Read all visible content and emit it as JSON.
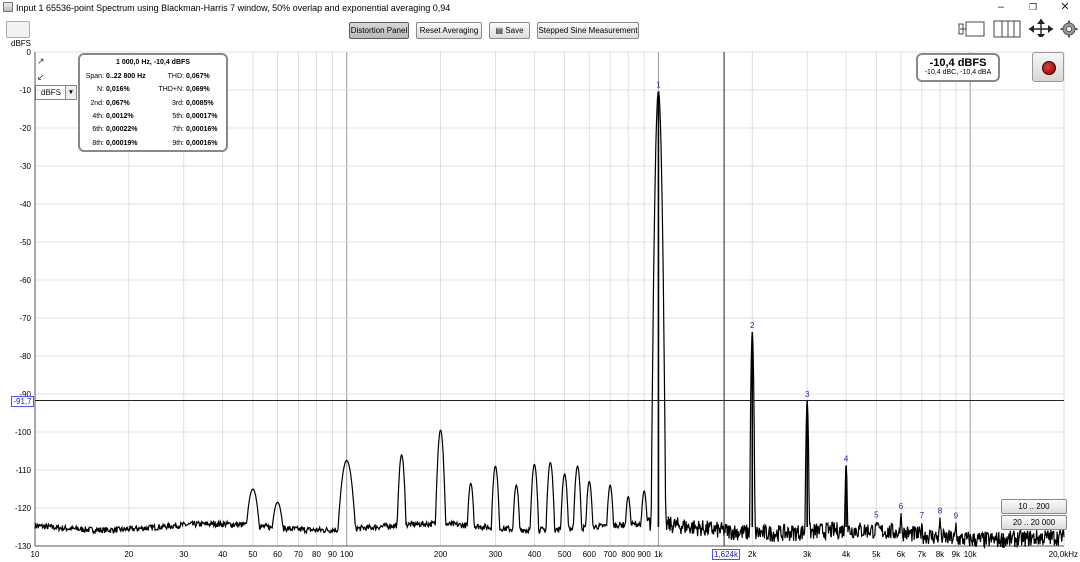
{
  "window": {
    "title": "Input 1 65536-point Spectrum using Blackman-Harris 7 window, 50% overlap and exponential averaging 0,94"
  },
  "toolbar": {
    "distortion": "Distortion Panel",
    "reset": "Reset Averaging",
    "save": "Save",
    "stepped": "Stepped Sine Measurement"
  },
  "unit_label": "dBFS",
  "unit_select": "dBFS",
  "info": {
    "header": "1 000,0 Hz, -10,4 dBFS",
    "rows": [
      [
        {
          "k": "Span:",
          "v": "0..22 800 Hz"
        },
        {
          "k": "THD:",
          "v": "0,067%"
        }
      ],
      [
        {
          "k": "N:",
          "v": "0,016%"
        },
        {
          "k": "THD+N:",
          "v": "0,069%"
        }
      ],
      [
        {
          "k": "2nd:",
          "v": "0,067%"
        },
        {
          "k": "3rd:",
          "v": "0,0085%"
        }
      ],
      [
        {
          "k": "4th:",
          "v": "0,0012%"
        },
        {
          "k": "5th:",
          "v": "0,00017%"
        }
      ],
      [
        {
          "k": "6th:",
          "v": "0,00022%"
        },
        {
          "k": "7th:",
          "v": "0,00016%"
        }
      ],
      [
        {
          "k": "8th:",
          "v": "0,00019%"
        },
        {
          "k": "9th:",
          "v": "0,00016%"
        }
      ]
    ]
  },
  "peak": {
    "level": "-10,4 dBFS",
    "weighted": "-10,4 dBC, -10,4 dBA"
  },
  "range": {
    "narrow": "10 .. 200",
    "wide": "20 .. 20 000"
  },
  "cursor": {
    "x_label": "1,624k",
    "y_label": "-91,7",
    "x": 1624,
    "y": -91.7
  },
  "colors": {
    "trace": "#000000",
    "grid_major": "#9a9a9a",
    "grid_minor": "#d8d8d8",
    "harmonic_label": "#1a1ac8"
  },
  "chart_data": {
    "type": "line",
    "x_scale": "log",
    "xlim": [
      10,
      20000
    ],
    "ylim": [
      -130,
      0
    ],
    "ylabel": "dBFS",
    "xlabel": "",
    "x_ticks": [
      {
        "v": 10,
        "l": "10"
      },
      {
        "v": 20,
        "l": "20"
      },
      {
        "v": 30,
        "l": "30"
      },
      {
        "v": 40,
        "l": "40"
      },
      {
        "v": 50,
        "l": "50"
      },
      {
        "v": 60,
        "l": "60"
      },
      {
        "v": 70,
        "l": "70"
      },
      {
        "v": 80,
        "l": "80"
      },
      {
        "v": 90,
        "l": "90"
      },
      {
        "v": 100,
        "l": "100"
      },
      {
        "v": 200,
        "l": "200"
      },
      {
        "v": 300,
        "l": "300"
      },
      {
        "v": 400,
        "l": "400"
      },
      {
        "v": 500,
        "l": "500"
      },
      {
        "v": 600,
        "l": "600"
      },
      {
        "v": 700,
        "l": "700"
      },
      {
        "v": 800,
        "l": "800"
      },
      {
        "v": 900,
        "l": "900"
      },
      {
        "v": 1000,
        "l": "1k"
      },
      {
        "v": 2000,
        "l": "2k"
      },
      {
        "v": 3000,
        "l": "3k"
      },
      {
        "v": 4000,
        "l": "4k"
      },
      {
        "v": 5000,
        "l": "5k"
      },
      {
        "v": 6000,
        "l": "6k"
      },
      {
        "v": 7000,
        "l": "7k"
      },
      {
        "v": 8000,
        "l": "8k"
      },
      {
        "v": 9000,
        "l": "9k"
      },
      {
        "v": 10000,
        "l": "10k"
      },
      {
        "v": 20000,
        "l": "20,0kHz"
      }
    ],
    "y_ticks": [
      0,
      -10,
      -20,
      -30,
      -40,
      -50,
      -60,
      -70,
      -80,
      -90,
      -100,
      -110,
      -120,
      -130
    ],
    "y_tick_labels": [
      "0",
      "-10",
      "-20",
      "-30",
      "-40",
      "-50",
      "-60",
      "-70",
      "-80",
      "-90",
      "-100",
      "-110",
      "-120",
      "-130"
    ],
    "noise_floor": -125,
    "harmonics": [
      {
        "n": "1",
        "f": 1000,
        "db": -10.4
      },
      {
        "n": "2",
        "f": 2000,
        "db": -73.7
      },
      {
        "n": "3",
        "f": 3000,
        "db": -91.8
      },
      {
        "n": "4",
        "f": 4000,
        "db": -108.8
      },
      {
        "n": "5",
        "f": 5000,
        "db": -123.5
      },
      {
        "n": "6",
        "f": 6000,
        "db": -121.3
      },
      {
        "n": "7",
        "f": 7000,
        "db": -123.7
      },
      {
        "n": "8",
        "f": 8000,
        "db": -122.5
      },
      {
        "n": "9",
        "f": 9000,
        "db": -123.8
      }
    ],
    "spurs": [
      {
        "f": 50,
        "db": -115
      },
      {
        "f": 60,
        "db": -118.5
      },
      {
        "f": 100,
        "db": -107.5
      },
      {
        "f": 150,
        "db": -106
      },
      {
        "f": 200,
        "db": -99.5
      },
      {
        "f": 250,
        "db": -113.5
      },
      {
        "f": 300,
        "db": -109
      },
      {
        "f": 350,
        "db": -114
      },
      {
        "f": 400,
        "db": -108.5
      },
      {
        "f": 450,
        "db": -108
      },
      {
        "f": 500,
        "db": -111
      },
      {
        "f": 550,
        "db": -109
      },
      {
        "f": 600,
        "db": -113
      },
      {
        "f": 700,
        "db": -114
      },
      {
        "f": 800,
        "db": -117
      },
      {
        "f": 900,
        "db": -115.5
      }
    ]
  }
}
